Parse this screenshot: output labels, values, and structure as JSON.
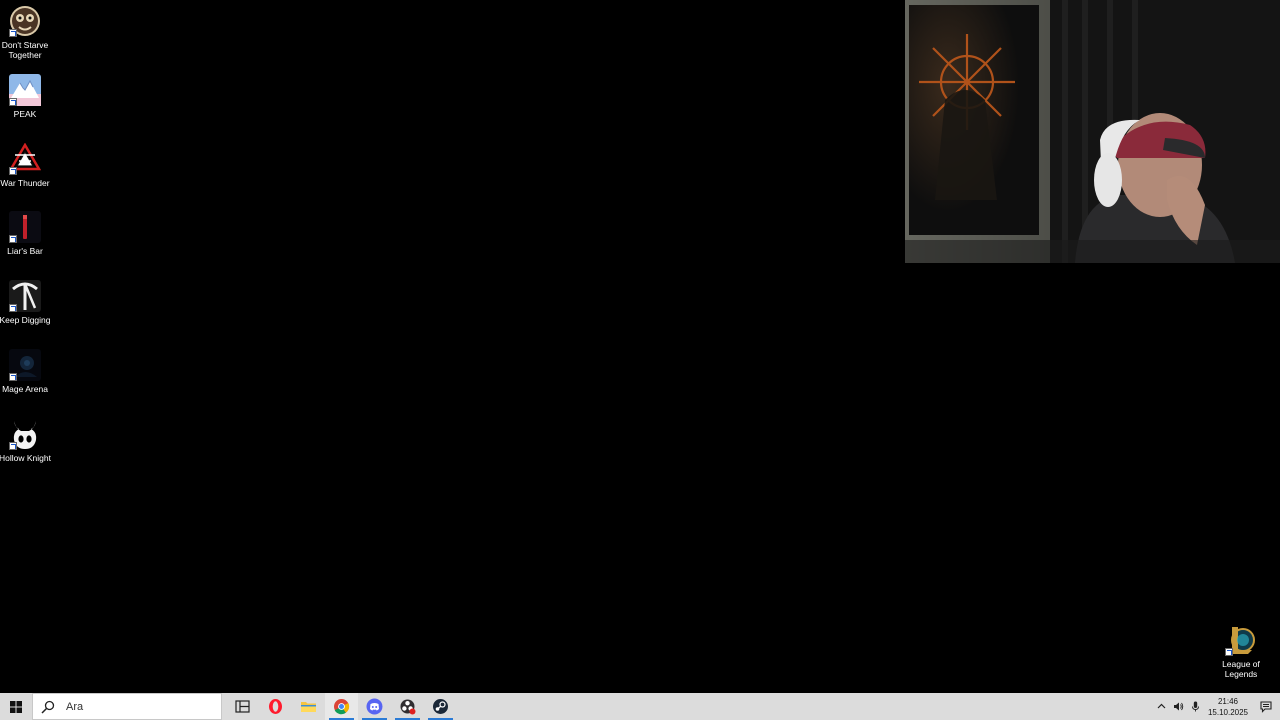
{
  "desktop": {
    "icons": [
      {
        "label": "Don't Starve Together",
        "icon": "dont-starve-together-icon"
      },
      {
        "label": "PEAK",
        "icon": "peak-icon"
      },
      {
        "label": "War Thunder",
        "icon": "war-thunder-icon"
      },
      {
        "label": "Liar's Bar",
        "icon": "liars-bar-icon"
      },
      {
        "label": "Keep Digging",
        "icon": "keep-digging-icon"
      },
      {
        "label": "Mage Arena",
        "icon": "mage-arena-icon"
      },
      {
        "label": "Hollow Knight",
        "icon": "hollow-knight-icon"
      },
      {
        "label": "League of Legends",
        "icon": "league-of-legends-icon"
      }
    ]
  },
  "taskbar": {
    "search_placeholder": "Ara",
    "apps": [
      {
        "name": "Task View",
        "icon": "task-view-icon"
      },
      {
        "name": "Opera",
        "icon": "opera-icon"
      },
      {
        "name": "File Explorer",
        "icon": "folder-icon"
      },
      {
        "name": "Google Chrome",
        "icon": "chrome-icon"
      },
      {
        "name": "Discord",
        "icon": "discord-icon"
      },
      {
        "name": "OBS",
        "icon": "obs-icon"
      },
      {
        "name": "Steam",
        "icon": "steam-icon"
      }
    ],
    "clock": {
      "time": "21:46",
      "date": "15.10.2025"
    }
  },
  "colors": {
    "taskbar_bg": "#dcdcdc",
    "accent": "#2b7bd6",
    "desktop_bg": "#000000"
  }
}
